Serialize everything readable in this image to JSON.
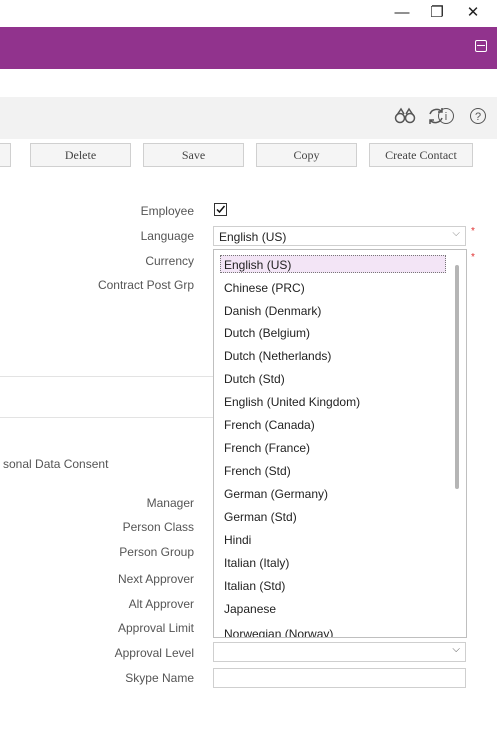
{
  "window": {
    "minimize_glyph": "—",
    "maximize_glyph": "❐",
    "close_glyph": "✕"
  },
  "toolbar": {
    "icons": [
      "binoculars-icon",
      "refresh-icon",
      "info-icon",
      "help-icon"
    ],
    "buttons": {
      "delete": "Delete",
      "save": "Save",
      "copy": "Copy",
      "create_contact": "Create Contact"
    }
  },
  "form": {
    "employee_label": "Employee",
    "employee_checked": true,
    "language_label": "Language",
    "language_value": "English (US)",
    "currency_label": "Currency",
    "contract_post_grp_label": "Contract Post Grp",
    "personal_data_consent_label": "sonal Data Consent",
    "manager_label": "Manager",
    "person_class_label": "Person Class",
    "person_group_label": "Person Group",
    "next_approver_label": "Next Approver",
    "alt_approver_label": "Alt Approver",
    "approval_limit_label": "Approval Limit",
    "approval_level_label": "Approval Level",
    "skype_name_label": "Skype Name",
    "required_marker": "*"
  },
  "language_options": [
    "English (US)",
    "Chinese (PRC)",
    "Danish (Denmark)",
    "Dutch (Belgium)",
    "Dutch (Netherlands)",
    "Dutch (Std)",
    "English (United Kingdom)",
    "French (Canada)",
    "French (France)",
    "French (Std)",
    "German (Germany)",
    "German (Std)",
    "Hindi",
    "Italian (Italy)",
    "Italian (Std)",
    "Japanese",
    "Norwegian (Norway)"
  ],
  "colors": {
    "header": "#91338d",
    "required": "#e03030"
  }
}
